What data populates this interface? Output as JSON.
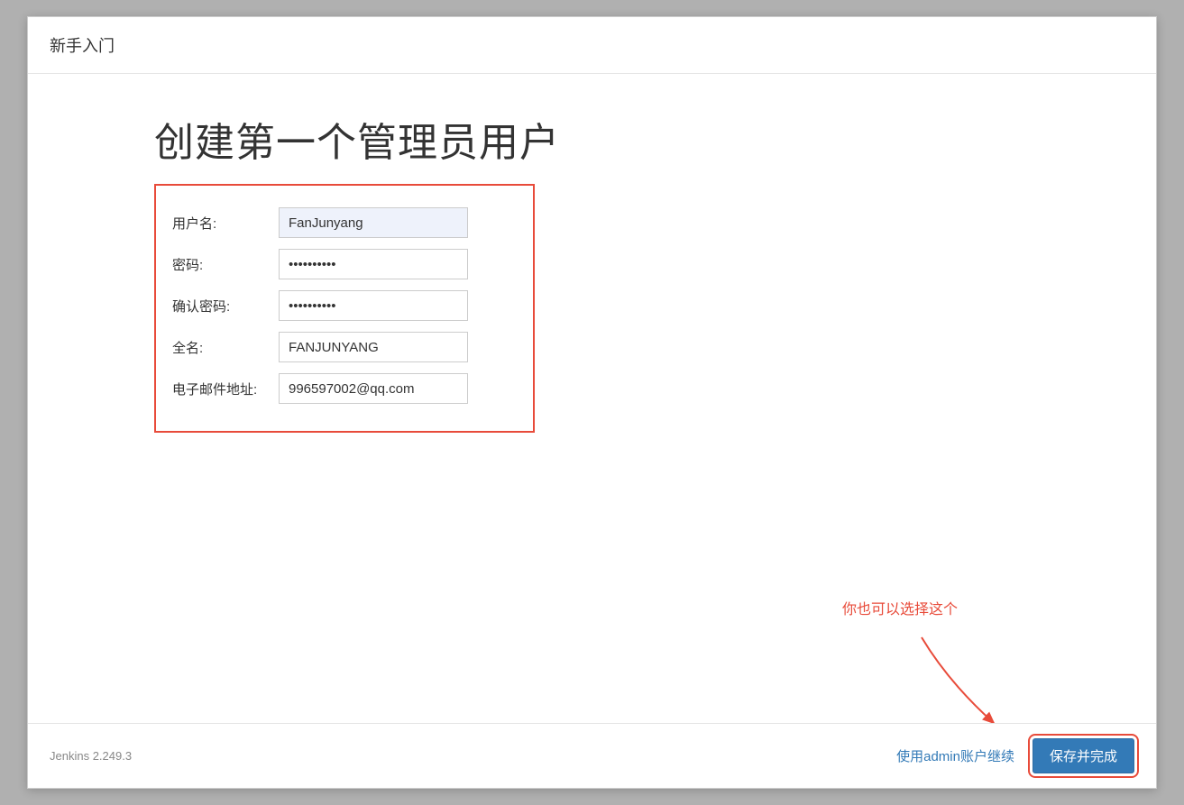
{
  "header": {
    "title": "新手入门"
  },
  "main": {
    "title": "创建第一个管理员用户",
    "form": {
      "username": {
        "label": "用户名:",
        "value": "FanJunyang"
      },
      "password": {
        "label": "密码:",
        "value": "••••••••••"
      },
      "confirm_password": {
        "label": "确认密码:",
        "value": "••••••••••"
      },
      "fullname": {
        "label": "全名:",
        "value": "FANJUNYANG"
      },
      "email": {
        "label": "电子邮件地址:",
        "value": "996597002@qq.com"
      }
    },
    "annotation": "你也可以选择这个"
  },
  "footer": {
    "version": "Jenkins 2.249.3",
    "skip_label": "使用admin账户继续",
    "save_label": "保存并完成"
  }
}
